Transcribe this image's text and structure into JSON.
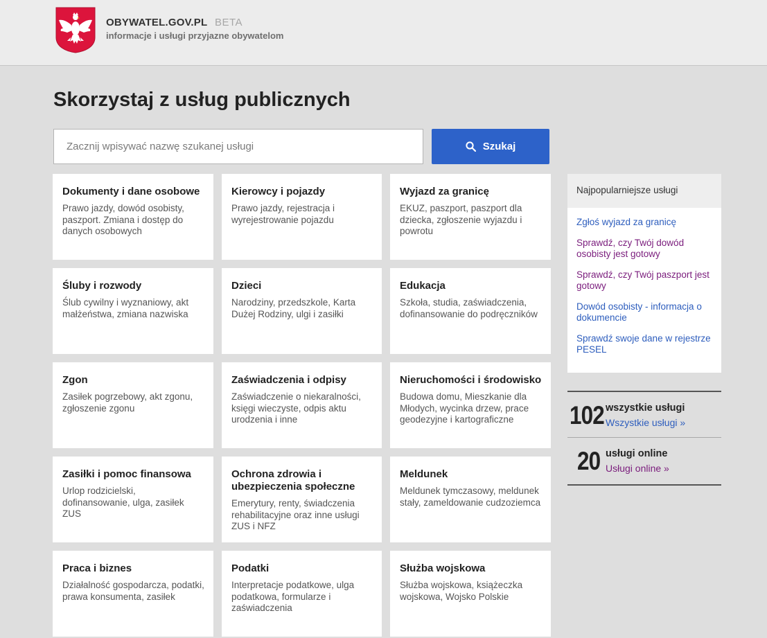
{
  "header": {
    "brand_name": "OBYWATEL.GOV.PL",
    "beta_label": "BETA",
    "tagline": "informacje i usługi przyjazne obywatelom",
    "emblem_icon": "polish-eagle-emblem-icon"
  },
  "main": {
    "title": "Skorzystaj z usług publicznych",
    "search": {
      "placeholder": "Zacznij wpisywać nazwę szukanej usługi",
      "value": "",
      "button_label": "Szukaj",
      "button_icon": "search-icon"
    },
    "categories": [
      {
        "title": "Dokumenty i dane osobowe",
        "desc": "Prawo jazdy, dowód osobisty, paszport. Zmiana i dostęp do danych osobowych"
      },
      {
        "title": "Kierowcy i pojazdy",
        "desc": "Prawo jazdy, rejestracja i wyrejestrowanie pojazdu"
      },
      {
        "title": "Wyjazd za granicę",
        "desc": "EKUZ, paszport, paszport dla dziecka, zgłoszenie wyjazdu i powrotu"
      },
      {
        "title": "Śluby i rozwody",
        "desc": "Ślub cywilny i wyznaniowy, akt małżeństwa, zmiana nazwiska"
      },
      {
        "title": "Dzieci",
        "desc": "Narodziny, przedszkole, Karta Dużej Rodziny, ulgi i zasiłki"
      },
      {
        "title": "Edukacja",
        "desc": "Szkoła, studia, zaświadczenia, dofinansowanie do podręczników"
      },
      {
        "title": "Zgon",
        "desc": "Zasiłek pogrzebowy, akt zgonu, zgłoszenie zgonu"
      },
      {
        "title": "Zaświadczenia i odpisy",
        "desc": "Zaświadczenie o niekaralności, księgi wieczyste, odpis aktu urodzenia i inne"
      },
      {
        "title": "Nieruchomości i środowisko",
        "desc": "Budowa domu, Mieszkanie dla Młodych, wycinka drzew, prace geodezyjne i kartograficzne"
      },
      {
        "title": "Zasiłki i pomoc finansowa",
        "desc": "Urlop rodzicielski, dofinansowanie, ulga, zasiłek ZUS"
      },
      {
        "title": "Ochrona zdrowia i ubezpieczenia społeczne",
        "desc": "Emerytury, renty, świadczenia rehabilitacyjne oraz inne usługi ZUS i NFZ"
      },
      {
        "title": "Meldunek",
        "desc": "Meldunek tymczasowy, meldunek stały, zameldowanie cudzoziemca"
      },
      {
        "title": "Praca i biznes",
        "desc": "Działalność gospodarcza, podatki, prawa konsumenta, zasiłek"
      },
      {
        "title": "Podatki",
        "desc": "Interpretacje podatkowe, ulga podatkowa, formularze i zaświadczenia"
      },
      {
        "title": "Służba wojskowa",
        "desc": "Służba wojskowa, książeczka wojskowa, Wojsko Polskie"
      }
    ]
  },
  "sidebar": {
    "popular_title": "Najpopularniejsze usługi",
    "popular_links": [
      {
        "label": "Zgłoś wyjazd za granicę",
        "color": "#2d5dbd"
      },
      {
        "label": "Sprawdź, czy Twój dowód osobisty jest gotowy",
        "color": "#7a1c7c"
      },
      {
        "label": "Sprawdź, czy Twój paszport jest gotowy",
        "color": "#7a1c7c"
      },
      {
        "label": "Dowód osobisty - informacja o dokumencie",
        "color": "#2d5dbd"
      },
      {
        "label": "Sprawdź swoje dane w rejestrze PESEL",
        "color": "#2d5dbd"
      }
    ],
    "stats": [
      {
        "number": "102",
        "label": "wszystkie usługi",
        "link": "Wszystkie usługi »"
      },
      {
        "number": "20",
        "label": "usługi online",
        "link": "Usługi online »"
      }
    ]
  },
  "colors": {
    "accent": "#2d62c9",
    "link_blue": "#2d5dbd",
    "link_visited": "#7a1c7c",
    "emblem_red": "#dc143c"
  }
}
